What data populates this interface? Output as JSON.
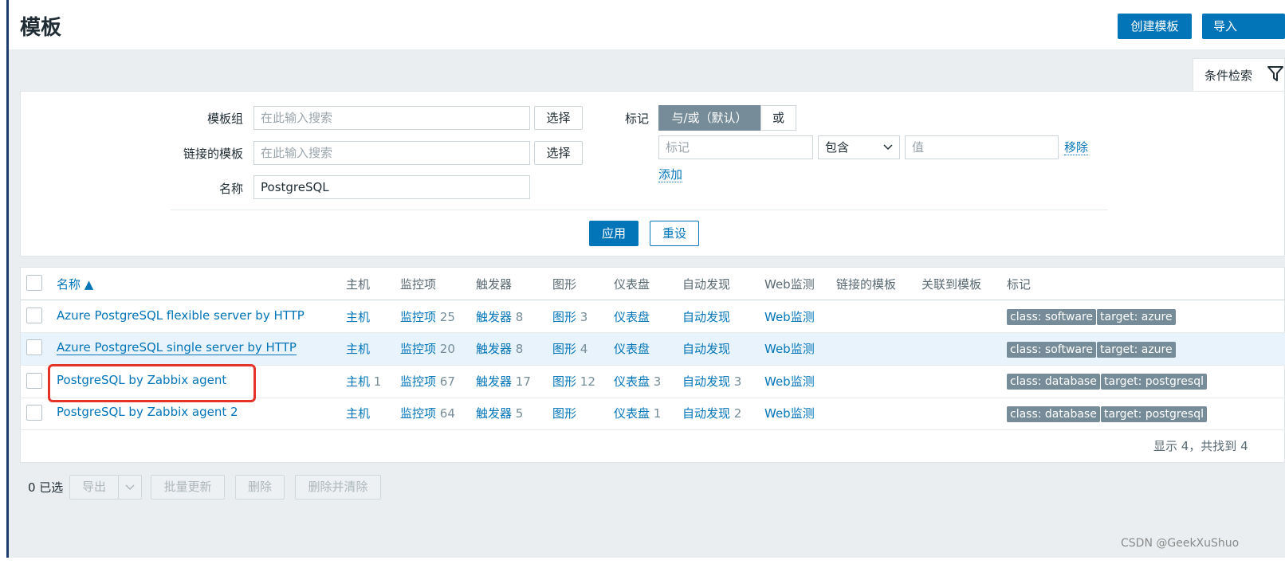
{
  "header": {
    "title": "模板",
    "help": "?",
    "create_label": "创建模板",
    "import_label": "导入"
  },
  "filter": {
    "tab_label": "条件检索",
    "template_group_label": "模板组",
    "template_group_placeholder": "在此输入搜索",
    "linked_templates_label": "链接的模板",
    "linked_templates_placeholder": "在此输入搜索",
    "name_label": "名称",
    "name_value": "PostgreSQL",
    "select_label": "选择",
    "tags_label": "标记",
    "tag_mode_and_or": "与/或（默认）",
    "tag_mode_or": "或",
    "tag_name_placeholder": "标记",
    "tag_operator": "包含",
    "tag_value_placeholder": "值",
    "remove_label": "移除",
    "add_label": "添加",
    "apply_label": "应用",
    "reset_label": "重设"
  },
  "table": {
    "columns": [
      "名称 ▲",
      "主机",
      "监控项",
      "触发器",
      "图形",
      "仪表盘",
      "自动发现",
      "Web监测",
      "链接的模板",
      "关联到模板",
      "标记"
    ],
    "rows": [
      {
        "name": "Azure PostgreSQL flexible server by HTTP",
        "hosts": "主机",
        "hosts_count": "",
        "items": "监控项",
        "items_count": "25",
        "triggers": "触发器",
        "triggers_count": "8",
        "graphs": "图形",
        "graphs_count": "3",
        "dashboards": "仪表盘",
        "dashboards_count": "",
        "discovery": "自动发现",
        "discovery_count": "",
        "web": "Web监测",
        "tags": [
          "class: software",
          "target: azure"
        ]
      },
      {
        "name": "Azure PostgreSQL single server by HTTP",
        "hosts": "主机",
        "hosts_count": "",
        "items": "监控项",
        "items_count": "20",
        "triggers": "触发器",
        "triggers_count": "8",
        "graphs": "图形",
        "graphs_count": "4",
        "dashboards": "仪表盘",
        "dashboards_count": "",
        "discovery": "自动发现",
        "discovery_count": "",
        "web": "Web监测",
        "tags": [
          "class: software",
          "target: azure"
        ]
      },
      {
        "name": "PostgreSQL by Zabbix agent",
        "hosts": "主机",
        "hosts_count": "1",
        "items": "监控项",
        "items_count": "67",
        "triggers": "触发器",
        "triggers_count": "17",
        "graphs": "图形",
        "graphs_count": "12",
        "dashboards": "仪表盘",
        "dashboards_count": "3",
        "discovery": "自动发现",
        "discovery_count": "3",
        "web": "Web监测",
        "tags": [
          "class: database",
          "target: postgresql"
        ]
      },
      {
        "name": "PostgreSQL by Zabbix agent 2",
        "hosts": "主机",
        "hosts_count": "",
        "items": "监控项",
        "items_count": "64",
        "triggers": "触发器",
        "triggers_count": "5",
        "graphs": "图形",
        "graphs_count": "",
        "dashboards": "仪表盘",
        "dashboards_count": "1",
        "discovery": "自动发现",
        "discovery_count": "2",
        "web": "Web监测",
        "tags": [
          "class: database",
          "target: postgresql"
        ]
      }
    ],
    "footer": "显示 4，共找到 4"
  },
  "actions": {
    "selected": "0 已选",
    "export": "导出",
    "mass_update": "批量更新",
    "delete": "删除",
    "delete_clear": "删除并清除"
  },
  "watermark": "CSDN @GeekXuShuo"
}
